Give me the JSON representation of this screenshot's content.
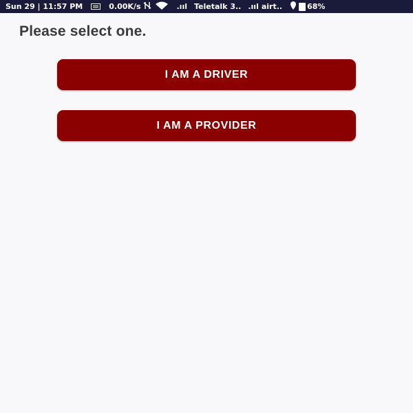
{
  "status_bar": {
    "datetime": "Sun 29 | 11:57 PM",
    "network_speed": "0.00K/s",
    "signal_1": ".ııl",
    "carrier_1": "Teletalk 3..",
    "signal_2": ".ııl",
    "carrier_2": "airt..",
    "battery": "68%",
    "icons": [
      "message-icon",
      "vibrate-icon",
      "wifi-icon",
      "signal-icon",
      "location-icon",
      "battery-icon"
    ]
  },
  "page": {
    "title": "Please select one."
  },
  "buttons": {
    "driver_label": "I AM A DRIVER",
    "provider_label": "I AM A PROVIDER"
  },
  "colors": {
    "status_bar_bg": "#1a1a3a",
    "button_bg": "#8b0000",
    "page_bg": "#f8f8fa",
    "title_text": "#3a3a3a"
  }
}
